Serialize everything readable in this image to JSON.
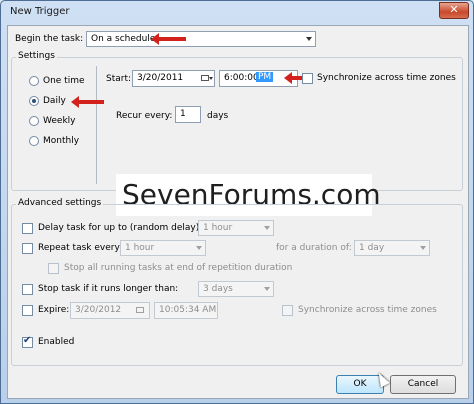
{
  "window": {
    "title": "New Trigger",
    "close_glyph": "✕"
  },
  "begin": {
    "label": "Begin the task:",
    "value": "On a schedule"
  },
  "settings": {
    "group_title": "Settings",
    "radios": [
      {
        "label": "One time",
        "selected": false
      },
      {
        "label": "Daily",
        "selected": true
      },
      {
        "label": "Weekly",
        "selected": false
      },
      {
        "label": "Monthly",
        "selected": false
      }
    ],
    "start_label": "Start:",
    "start_date": "3/20/2011",
    "start_time": "6:00:00",
    "start_ampm": "PM",
    "sync_label": "Synchronize across time zones",
    "recur_label": "Recur every:",
    "recur_value": "1",
    "recur_unit": "days"
  },
  "watermark": "SevenForums.com",
  "advanced": {
    "group_title": "Advanced settings",
    "delay_label": "Delay task for up to (random delay):",
    "delay_value": "1 hour",
    "repeat_label": "Repeat task every:",
    "repeat_value": "1 hour",
    "duration_label": "for a duration of:",
    "duration_value": "1 day",
    "stop_all_label": "Stop all running tasks at end of repetition duration",
    "stop_longer_label": "Stop task if it runs longer than:",
    "stop_longer_value": "3 days",
    "expire_label": "Expire:",
    "expire_date": "3/20/2012",
    "expire_time": "10:05:34 AM",
    "expire_sync_label": "Synchronize across time zones",
    "enabled_label": "Enabled",
    "enabled_checked": true
  },
  "buttons": {
    "ok": "OK",
    "cancel": "Cancel"
  },
  "colors": {
    "annotation_arrow": "#d3211b",
    "selection_highlight": "#3399ff"
  }
}
